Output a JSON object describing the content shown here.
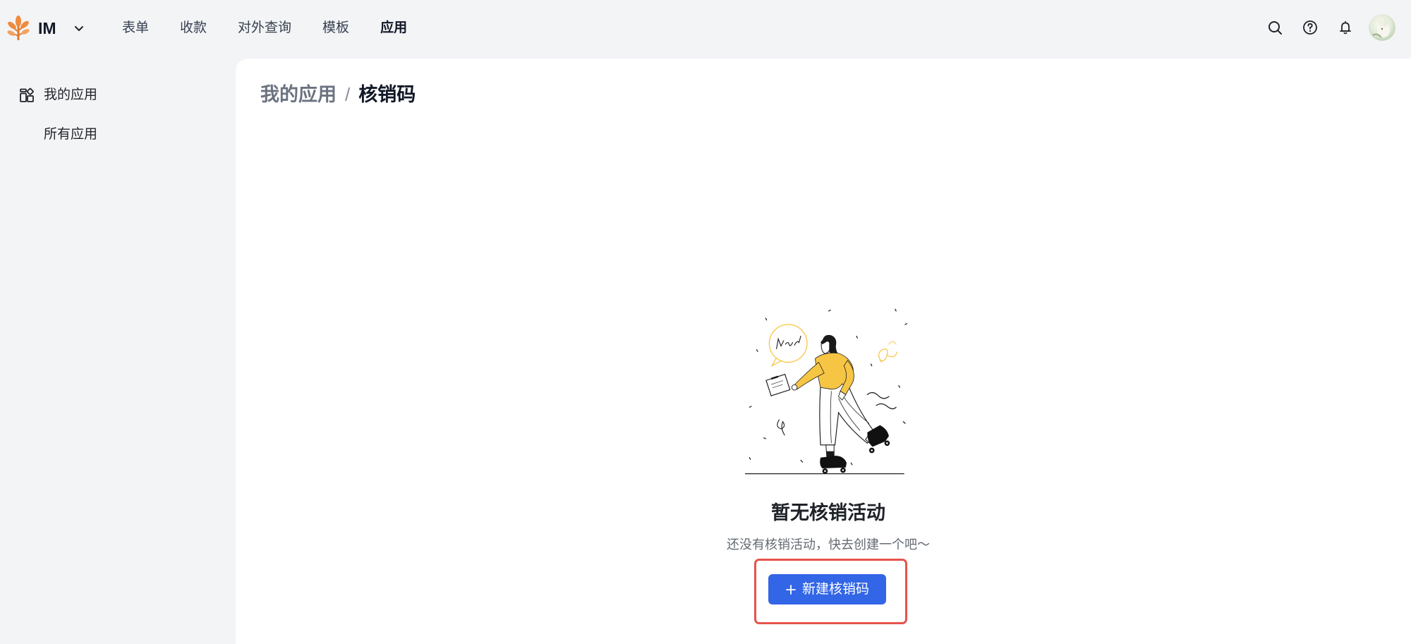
{
  "theme": {
    "primary": "#3366e6",
    "highlight": "#e5534b",
    "logo": "#f08a3e",
    "illustration_accent": "#f6c544",
    "chrome_bg": "#f3f4f6"
  },
  "header": {
    "logo_icon": "tree-logo-icon",
    "app_name": "IM",
    "switcher_icon": "chevron-down-icon",
    "nav": [
      {
        "label": "表单",
        "active": false
      },
      {
        "label": "收款",
        "active": false
      },
      {
        "label": "对外查询",
        "active": false
      },
      {
        "label": "模板",
        "active": false
      },
      {
        "label": "应用",
        "active": true
      }
    ],
    "actions": [
      "search-icon",
      "help-icon",
      "bell-icon"
    ],
    "avatar_icon": "user-avatar"
  },
  "sidebar": {
    "group": {
      "label": "我的应用",
      "icon": "apps-icon"
    },
    "items": [
      {
        "label": "所有应用"
      }
    ]
  },
  "breadcrumb": {
    "parent": "我的应用",
    "separator": "/",
    "current": "核销码"
  },
  "empty_state": {
    "illustration": "roller-skater-illustration",
    "title": "暂无核销活动",
    "description": "还没有核销活动，快去创建一个吧～",
    "button_icon": "plus-icon",
    "button_label": "新建核销码"
  }
}
